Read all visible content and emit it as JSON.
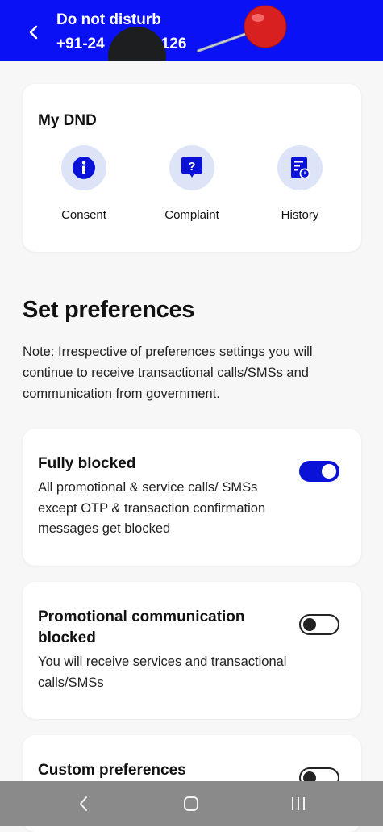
{
  "header": {
    "title": "Do not disturb",
    "phone": "+91-24",
    "phone_tail": "126"
  },
  "dnd_card": {
    "title": "My DND",
    "actions": [
      {
        "label": "Consent",
        "icon": "info-icon"
      },
      {
        "label": "Complaint",
        "icon": "question-chat-icon"
      },
      {
        "label": "History",
        "icon": "history-document-icon"
      }
    ]
  },
  "preferences": {
    "heading": "Set preferences",
    "note": "Note: Irrespective of preferences settings you will continue to receive transactional calls/SMSs and communication from government.",
    "items": [
      {
        "title": "Fully blocked",
        "description": "All promotional & service calls/ SMSs except OTP & transaction confirmation messages get blocked",
        "enabled": true
      },
      {
        "title": "Promotional communication blocked",
        "description": "You will receive services and transactional calls/SMSs",
        "enabled": false
      },
      {
        "title": "Custom preferences",
        "description": "",
        "enabled": false
      }
    ]
  },
  "colors": {
    "header_bg": "#0a12f5",
    "toggle_on": "#0a12d8",
    "icon_circle": "#dde4f7",
    "icon_fg": "#0a12d8"
  },
  "navbar": {
    "buttons": [
      "back-nav-icon",
      "home-nav-icon",
      "recents-nav-icon"
    ]
  }
}
